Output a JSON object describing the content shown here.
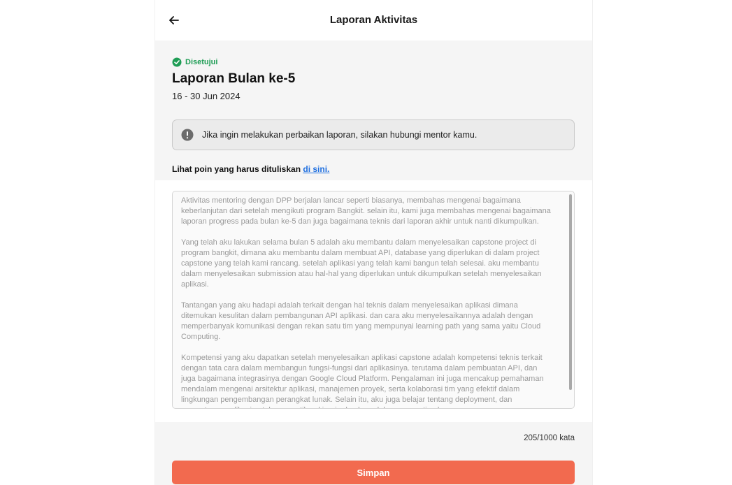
{
  "header": {
    "title": "Laporan Aktivitas",
    "back_icon": "arrow-left-icon"
  },
  "report": {
    "status": "Disetujui",
    "status_color": "#1f9d55",
    "title": "Laporan Bulan ke-5",
    "date_range": "16 - 30 Jun 2024"
  },
  "info": {
    "icon": "exclamation-circle-icon",
    "text": "Jika ingin melakukan perbaikan laporan, silakan hubungi mentor kamu."
  },
  "guide": {
    "prefix": "Lihat poin yang harus dituliskan ",
    "link_text": "di sini."
  },
  "editor": {
    "content": "Aktivitas mentoring dengan DPP berjalan lancar seperti biasanya, membahas mengenai bagaimana\nkeberlanjutan dari setelah mengikuti program Bangkit. selain itu, kami juga membahas mengenai bagaimana\nlaporan progress pada bulan ke-5 dan juga bagaimana teknis dari laporan akhir untuk nanti dikumpulkan.\n\nYang telah aku lakukan selama bulan 5 adalah aku membantu dalam menyelesaikan capstone project di\nprogram bangkit, dimana aku membantu dalam membuat API, database yang diperlukan di dalam project\ncapstone yang telah kami rancang. setelah aplikasi yang telah kami bangun telah selesai. aku membantu\ndalam menyelesaikan submission atau hal-hal yang diperlukan untuk dikumpulkan setelah menyelesaikan\naplikasi.\n\nTantangan yang aku hadapi adalah terkait dengan hal teknis dalam menyelesaikan aplikasi dimana\nditemukan kesulitan dalam pembangunan API aplikasi. dan cara aku menyelesaikannya adalah dengan\nmemperbanyak komunikasi dengan rekan satu tim yang mempunyai learning path yang sama yaitu Cloud\nComputing.\n\nKompetensi yang aku dapatkan setelah menyelesaikan aplikasi capstone adalah kompetensi teknis terkait\ndengan tata cara dalam membangun fungsi-fungsi dari aplikasinya. terutama dalam pembuatan API, dan\njuga bagaimana integrasinya dengan Google Cloud Platform. Pengalaman ini juga mencakup pemahaman\nmendalam mengenai arsitektur aplikasi, manajemen proyek, serta kolaborasi tim yang efektif dalam\nlingkungan pengembangan perangkat lunak. Selain itu, aku juga belajar tentang deployment, dan\npemantauan aplikasi untuk memastikan kinerja dan keandalan yang optimal.",
    "word_count": "205/1000 kata"
  },
  "actions": {
    "save_label": "Simpan",
    "save_color": "#f26a4f"
  }
}
